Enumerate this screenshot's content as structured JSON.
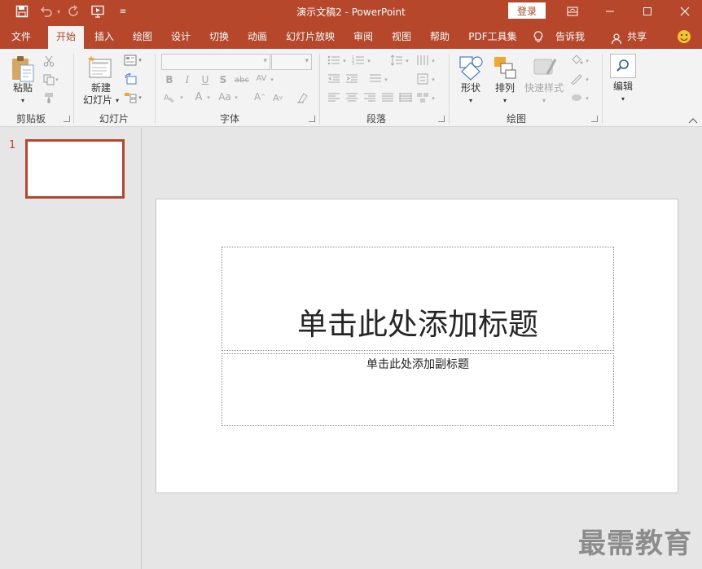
{
  "window": {
    "title": "演示文稿2  -  PowerPoint",
    "login_label": "登录"
  },
  "tabs": [
    {
      "label": "文件"
    },
    {
      "label": "开始"
    },
    {
      "label": "插入"
    },
    {
      "label": "绘图"
    },
    {
      "label": "设计"
    },
    {
      "label": "切换"
    },
    {
      "label": "动画"
    },
    {
      "label": "幻灯片放映"
    },
    {
      "label": "审阅"
    },
    {
      "label": "视图"
    },
    {
      "label": "帮助"
    },
    {
      "label": "PDF工具集"
    },
    {
      "label": "告诉我"
    },
    {
      "label": "共享"
    }
  ],
  "ribbon": {
    "clipboard": {
      "paste": "粘贴",
      "group": "剪贴板"
    },
    "slides": {
      "new_slide_1": "新建",
      "new_slide_2": "幻灯片",
      "group": "幻灯片"
    },
    "font": {
      "group": "字体"
    },
    "paragraph": {
      "group": "段落"
    },
    "drawing": {
      "shapes": "形状",
      "arrange": "排列",
      "quick_styles": "快速样式",
      "group": "绘图"
    },
    "editing": {
      "label": "编辑"
    }
  },
  "thumbnails": {
    "slide_number": "1"
  },
  "slide": {
    "title_placeholder": "单击此处添加标题",
    "subtitle_placeholder": "单击此处添加副标题"
  },
  "watermark": "最需教育"
}
